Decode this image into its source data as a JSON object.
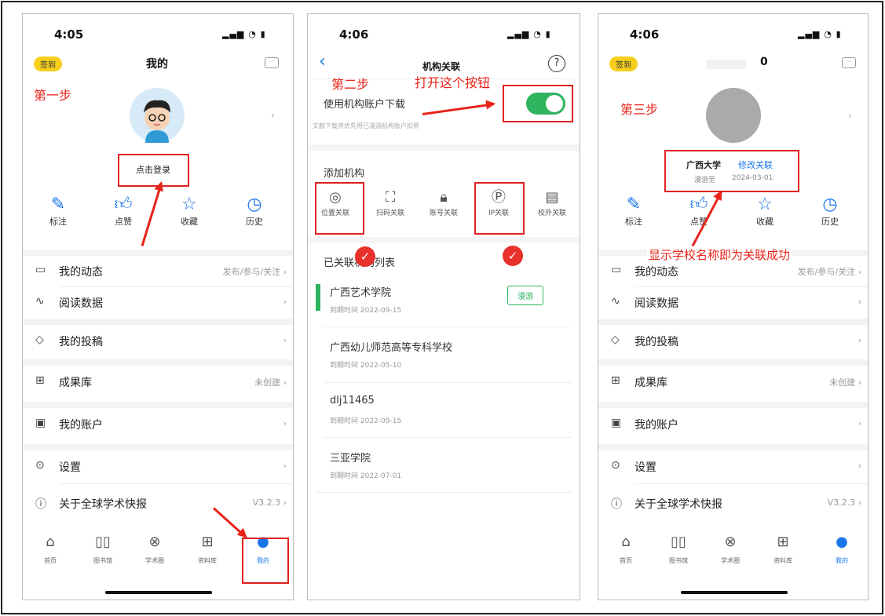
{
  "status_bar": {
    "p1_time": "4:05",
    "p2_time": "4:06",
    "p3_time": "4:06",
    "icons": "▂▄▆ ◔ ▮"
  },
  "p1": {
    "signin": "签到",
    "title": "我的",
    "step": "第一步",
    "login": "点击登录",
    "quick": [
      "标注",
      "点赞",
      "收藏",
      "历史"
    ],
    "menu": [
      {
        "label": "我的动态",
        "right": "发布/参与/关注"
      },
      {
        "label": "阅读数据",
        "right": ""
      },
      {
        "label": "我的投稿",
        "right": ""
      },
      {
        "label": "成果库",
        "right": "未创建"
      },
      {
        "label": "我的账户",
        "right": ""
      },
      {
        "label": "设置",
        "right": ""
      },
      {
        "label": "关于全球学术快报",
        "right": "V3.2.3"
      }
    ],
    "tabs": [
      "首页",
      "图书馆",
      "学术圈",
      "资料库",
      "我的"
    ]
  },
  "p2": {
    "title": "机构关联",
    "step": "第二步",
    "hint": "打开这个按钮",
    "use_account": "使用机构账户下载",
    "use_desc": "文献下载将优先用已漫游机构账户扣费",
    "add_org": "添加机构",
    "org_opts": [
      "位置关联",
      "扫码关联",
      "账号关联",
      "IP关联",
      "校外关联"
    ],
    "list_title": "已关联机构列表",
    "institutions": [
      {
        "name": "广西艺术学院",
        "date": "到期时间 2022-09-15",
        "roam": "漫游"
      },
      {
        "name": "广西幼儿师范高等专科学校",
        "date": "到期时间 2022-05-10"
      },
      {
        "name": "dlj11465",
        "date": "到期时间 2022-09-15"
      },
      {
        "name": "三亚学院",
        "date": "到期时间 2022-07-01"
      }
    ]
  },
  "p3": {
    "signin": "签到",
    "title": "0",
    "step": "第三步",
    "univ": "广西大学",
    "modify": "修改关联",
    "roam_label": "漫游至",
    "roam_date": "2024-03-01",
    "success": "显示学校名称即为关联成功",
    "quick": [
      "标注",
      "点赞",
      "收藏",
      "历史"
    ],
    "menu": [
      {
        "label": "我的动态",
        "right": "发布/参与/关注"
      },
      {
        "label": "阅读数据",
        "right": ""
      },
      {
        "label": "我的投稿",
        "right": ""
      },
      {
        "label": "成果库",
        "right": "未创建"
      },
      {
        "label": "我的账户",
        "right": ""
      },
      {
        "label": "设置",
        "right": ""
      },
      {
        "label": "关于全球学术快报",
        "right": "V3.2.3"
      }
    ],
    "tabs": [
      "首页",
      "图书馆",
      "学术圈",
      "资料库",
      "我的"
    ]
  },
  "colors": {
    "accent": "#1a75e8",
    "annotation": "#e8231a",
    "toggle": "#2eb45e",
    "signin": "#f7cf1c"
  }
}
